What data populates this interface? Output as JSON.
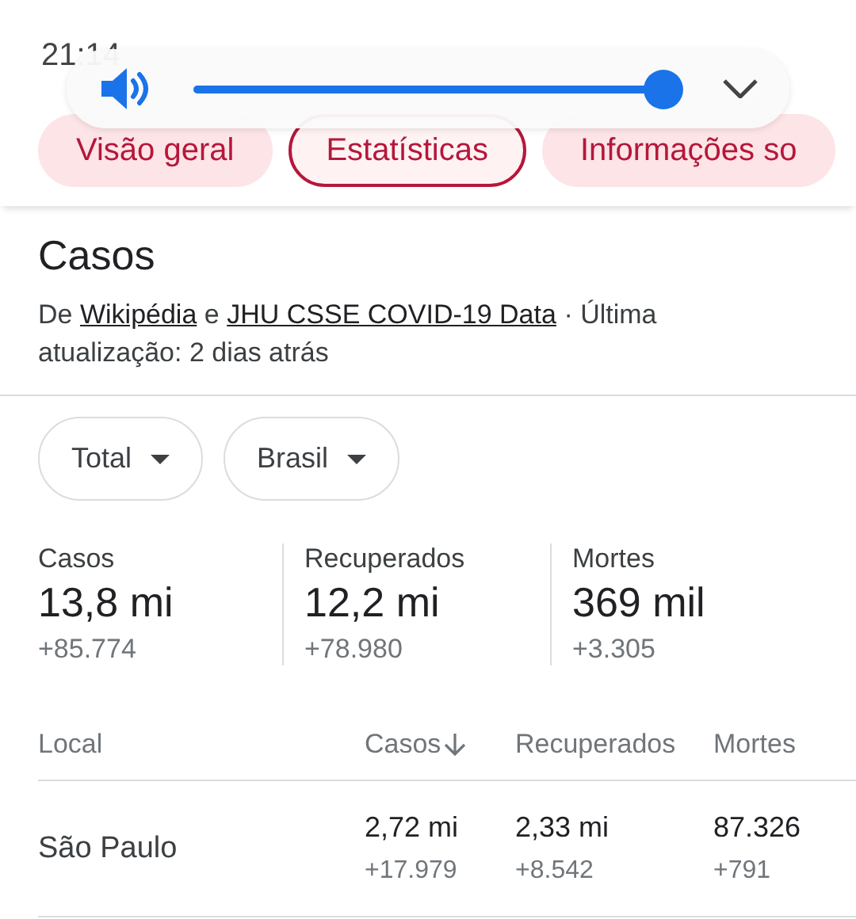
{
  "status_bar": {
    "time": "21:14"
  },
  "volume": {
    "level": 1
  },
  "tabs": [
    {
      "label": "Visão geral",
      "selected": false
    },
    {
      "label": "Estatísticas",
      "selected": true
    },
    {
      "label": "Informações so",
      "selected": false
    }
  ],
  "section": {
    "title": "Casos",
    "source": {
      "prefix": "De",
      "link_1": "Wikipédia",
      "joiner": "e",
      "link_2": "JHU CSSE COVID-19 Data",
      "suffix": "· Última atualização: 2 dias atrás"
    }
  },
  "filters": [
    {
      "label": "Total"
    },
    {
      "label": "Brasil"
    }
  ],
  "stats": [
    {
      "label": "Casos",
      "value": "13,8 mi",
      "delta": "+85.774"
    },
    {
      "label": "Recuperados",
      "value": "12,2 mi",
      "delta": "+78.980"
    },
    {
      "label": "Mortes",
      "value": "369 mil",
      "delta": "+3.305"
    }
  ],
  "table": {
    "columns": [
      {
        "label": "Local",
        "sorted": false
      },
      {
        "label": "Casos",
        "sorted": true
      },
      {
        "label": "Recuperados",
        "sorted": false
      },
      {
        "label": "Mortes",
        "sorted": false
      }
    ],
    "rows": [
      {
        "cells": [
          {
            "value": "São Paulo"
          },
          {
            "value": "2,72 mi",
            "delta": "+17.979"
          },
          {
            "value": "2,33 mi",
            "delta": "+8.542"
          },
          {
            "value": "87.326",
            "delta": "+791"
          }
        ]
      }
    ]
  }
}
